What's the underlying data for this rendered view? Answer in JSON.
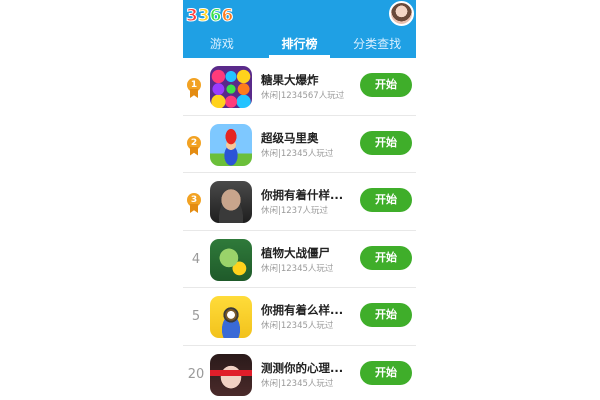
{
  "header": {
    "logo": {
      "text": "3366",
      "colors": [
        "#ff3b3b",
        "#ffd21c",
        "#3ce04a",
        "#ff7b1c"
      ]
    },
    "avatar_icon": "user-avatar"
  },
  "tabs": [
    {
      "label": "游戏",
      "active": false
    },
    {
      "label": "排行榜",
      "active": true
    },
    {
      "label": "分类查找",
      "active": false
    }
  ],
  "games": [
    {
      "rank": "1",
      "medal": true,
      "icon": "candy-crush-icon",
      "title": "糖果大爆炸",
      "sub": "休闲|1234567人玩过",
      "button": "开始"
    },
    {
      "rank": "2",
      "medal": true,
      "icon": "super-mario-icon",
      "title": "超级马里奥",
      "sub": "休闲|12345人玩过",
      "button": "开始"
    },
    {
      "rank": "3",
      "medal": true,
      "icon": "face-quiz-icon",
      "title": "你拥有着什样...",
      "sub": "休闲|1237人玩过",
      "button": "开始"
    },
    {
      "rank": "4",
      "medal": false,
      "icon": "plants-vs-zombies-icon",
      "title": "植物大战僵尸",
      "sub": "休闲|12345人玩过",
      "button": "开始"
    },
    {
      "rank": "5",
      "medal": false,
      "icon": "minion-icon",
      "title": "你拥有着么样...",
      "sub": "休闲|12345人玩过",
      "button": "开始"
    },
    {
      "rank": "20",
      "medal": false,
      "icon": "psych-test-icon",
      "title": "测测你的心理...",
      "sub": "休闲|12345人玩过",
      "button": "开始"
    }
  ],
  "colors": {
    "header": "#1fa0e4",
    "button": "#3fae2a",
    "medal": "#f2a223"
  }
}
